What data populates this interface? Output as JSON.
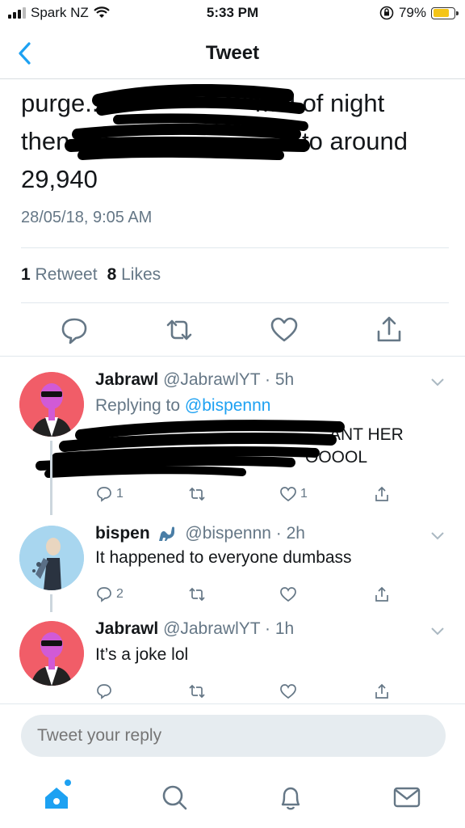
{
  "status_bar": {
    "carrier": "Spark NZ",
    "time": "5:33 PM",
    "battery": "79%",
    "battery_level": 0.79
  },
  "header": {
    "title": "Tweet"
  },
  "main_tweet": {
    "line1": "purge...",
    "line1_end": "mid of night",
    "line2_start": "then",
    "line2_end": "to around",
    "line3": "29,940",
    "timestamp": "28/05/18, 9:05 AM",
    "retweet_count": "1",
    "retweet_label": "Retweet",
    "like_count": "8",
    "like_label": "Likes"
  },
  "replies": [
    {
      "name": "Jabrawl",
      "handle": "@JabrawlYT · 5h",
      "replying_prefix": "Replying to",
      "replying_to": "@bispennn",
      "text_line1_end": "ANT HER",
      "text_line2_end": "OOOOL",
      "reply_count": "1",
      "retweet_count": "",
      "like_count": "1"
    },
    {
      "name": "bispen",
      "handle": "@bispennn · 2h",
      "text": "It happened to everyone dumbass",
      "reply_count": "2",
      "retweet_count": "",
      "like_count": ""
    },
    {
      "name": "Jabrawl",
      "handle": "@JabrawlYT · 1h",
      "text": "It’s a joke lol",
      "reply_count": "",
      "retweet_count": "",
      "like_count": ""
    }
  ],
  "reply_input": {
    "placeholder": "Tweet your reply"
  },
  "tabs": [
    "home-icon",
    "search-icon",
    "notifications-icon",
    "messages-icon"
  ],
  "colors": {
    "accent": "#1da1f2",
    "secondary_text": "#657786",
    "battery": "#f5c518"
  }
}
